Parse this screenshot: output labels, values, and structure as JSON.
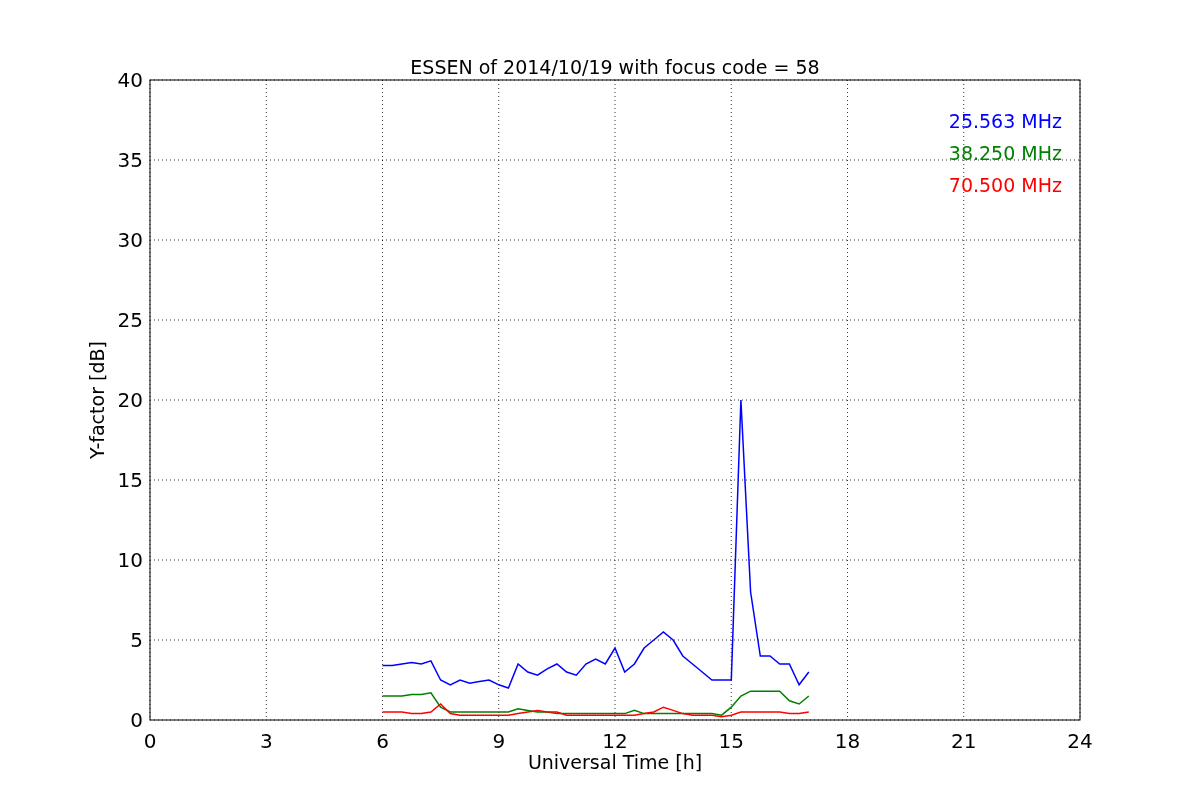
{
  "figure": {
    "chart_data": {
      "type": "line",
      "title": "ESSEN of 2014/10/19 with focus code = 58",
      "xlabel": "Universal Time [h]",
      "ylabel": "Y-factor [dB]",
      "x": [
        6,
        6.25,
        6.5,
        6.75,
        7,
        7.25,
        7.5,
        7.75,
        8,
        8.25,
        8.5,
        8.75,
        9,
        9.25,
        9.5,
        9.75,
        10,
        10.25,
        10.5,
        10.75,
        11,
        11.25,
        11.5,
        11.75,
        12,
        12.25,
        12.5,
        12.75,
        13,
        13.25,
        13.5,
        13.75,
        14,
        14.25,
        14.5,
        14.75,
        15,
        15.25,
        15.5,
        15.75,
        16,
        16.25,
        16.5,
        16.75,
        17
      ],
      "series": [
        {
          "name": "25.563 MHz",
          "color": "#0000ff",
          "values": [
            3.4,
            3.4,
            3.5,
            3.6,
            3.5,
            3.7,
            2.5,
            2.2,
            2.5,
            2.3,
            2.4,
            2.5,
            2.2,
            2.0,
            3.5,
            3.0,
            2.8,
            3.2,
            3.5,
            3.0,
            2.8,
            3.5,
            3.8,
            3.5,
            4.5,
            3.0,
            3.5,
            4.5,
            5.0,
            5.5,
            5.0,
            4.0,
            3.5,
            3.0,
            2.5,
            2.5,
            2.5,
            20.0,
            8.0,
            4.0,
            4.0,
            3.5,
            3.5,
            2.2,
            3.0
          ]
        },
        {
          "name": "38.250 MHz",
          "color": "#008000",
          "values": [
            1.5,
            1.5,
            1.5,
            1.6,
            1.6,
            1.7,
            0.8,
            0.5,
            0.5,
            0.5,
            0.5,
            0.5,
            0.5,
            0.5,
            0.7,
            0.6,
            0.5,
            0.5,
            0.4,
            0.4,
            0.4,
            0.4,
            0.4,
            0.4,
            0.4,
            0.4,
            0.6,
            0.4,
            0.4,
            0.4,
            0.4,
            0.4,
            0.4,
            0.4,
            0.4,
            0.3,
            0.8,
            1.5,
            1.8,
            1.8,
            1.8,
            1.8,
            1.2,
            1.0,
            1.5
          ]
        },
        {
          "name": "70.500 MHz",
          "color": "#ff0000",
          "values": [
            0.5,
            0.5,
            0.5,
            0.4,
            0.4,
            0.5,
            1.0,
            0.4,
            0.3,
            0.3,
            0.3,
            0.3,
            0.3,
            0.3,
            0.4,
            0.5,
            0.6,
            0.5,
            0.5,
            0.3,
            0.3,
            0.3,
            0.3,
            0.3,
            0.3,
            0.3,
            0.3,
            0.4,
            0.5,
            0.8,
            0.6,
            0.4,
            0.3,
            0.3,
            0.3,
            0.2,
            0.3,
            0.5,
            0.5,
            0.5,
            0.5,
            0.5,
            0.4,
            0.4,
            0.5
          ]
        }
      ],
      "grid": true,
      "xlim": [
        0,
        24
      ],
      "ylim": [
        0,
        40
      ],
      "xticks": [
        0,
        3,
        6,
        9,
        12,
        15,
        18,
        21,
        24
      ],
      "yticks": [
        0,
        5,
        10,
        15,
        20,
        25,
        30,
        35,
        40
      ]
    }
  }
}
